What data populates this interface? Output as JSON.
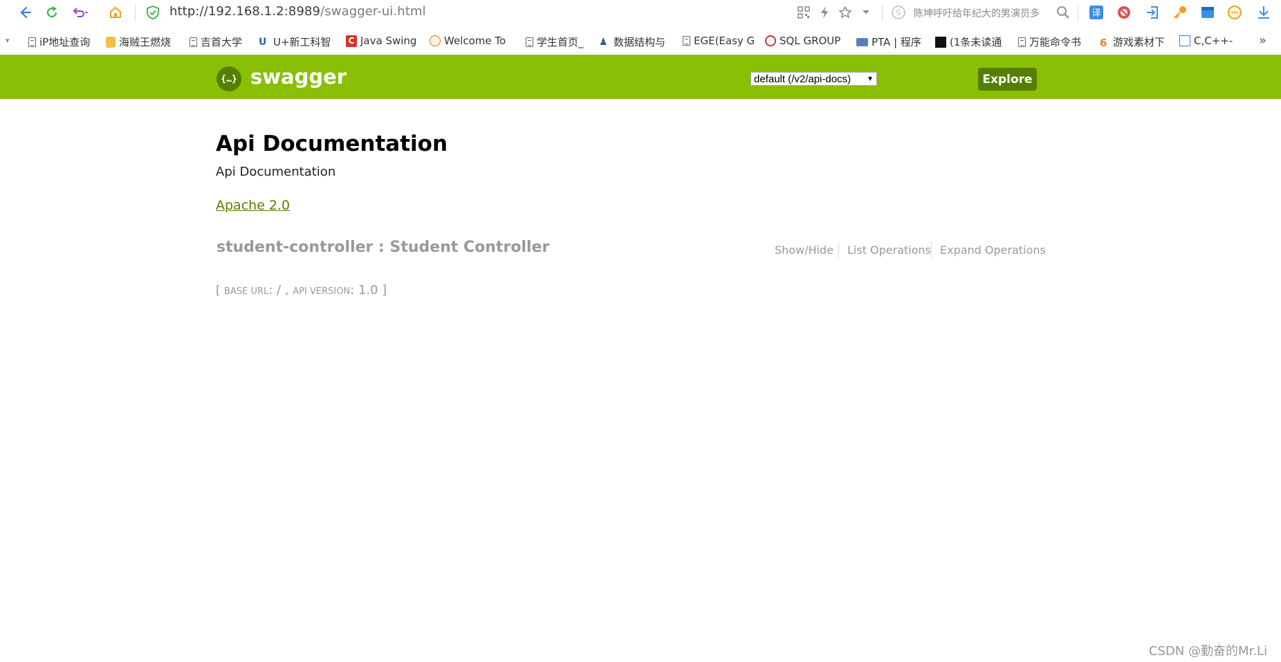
{
  "browser": {
    "url_host": "http://192.168.1.2:8989",
    "url_path": "/swagger-ui.html",
    "search_hint": "陈坤呼吁给年纪大的男演员多"
  },
  "bookmarks": [
    {
      "label": "iP地址查询",
      "icon": "doc-icon"
    },
    {
      "label": "海贼王燃烧",
      "icon": "image-icon"
    },
    {
      "label": "吉首大学",
      "icon": "doc-icon"
    },
    {
      "label": "U+新工科智",
      "icon": "u-icon"
    },
    {
      "label": "Java Swing",
      "icon": "c-red-icon"
    },
    {
      "label": "Welcome To",
      "icon": "face-icon"
    },
    {
      "label": "学生首页_",
      "icon": "doc-icon"
    },
    {
      "label": "数据结构与",
      "icon": "user-icon"
    },
    {
      "label": "EGE(Easy G",
      "icon": "doc-icon"
    },
    {
      "label": "SQL GROUP",
      "icon": "sql-icon"
    },
    {
      "label": "PTA | 程序",
      "icon": "pta-icon"
    },
    {
      "label": "(1条未读通",
      "icon": "black-icon"
    },
    {
      "label": "万能命令书",
      "icon": "doc-icon"
    },
    {
      "label": "游戏素材下",
      "icon": "six-icon"
    },
    {
      "label": "C,C++-",
      "icon": "blue-icon"
    }
  ],
  "swagger": {
    "brand": "swagger",
    "logo_glyph": "{…}",
    "api_select": "default (/v2/api-docs)",
    "explore_label": "Explore"
  },
  "doc": {
    "title": "Api Documentation",
    "description": "Api Documentation",
    "license": "Apache 2.0"
  },
  "controller": {
    "title": "student-controller : Student Controller",
    "show_hide": "Show/Hide",
    "list_ops": "List Operations",
    "expand_ops": "Expand Operations"
  },
  "base": {
    "open": "[ ",
    "base_url_label": "Base URL",
    "base_url_value": ": / , ",
    "api_version_label": "Api Version",
    "api_version_value": ": 1.0 ]"
  },
  "watermark": "CSDN @勤奋的Mr.Li"
}
